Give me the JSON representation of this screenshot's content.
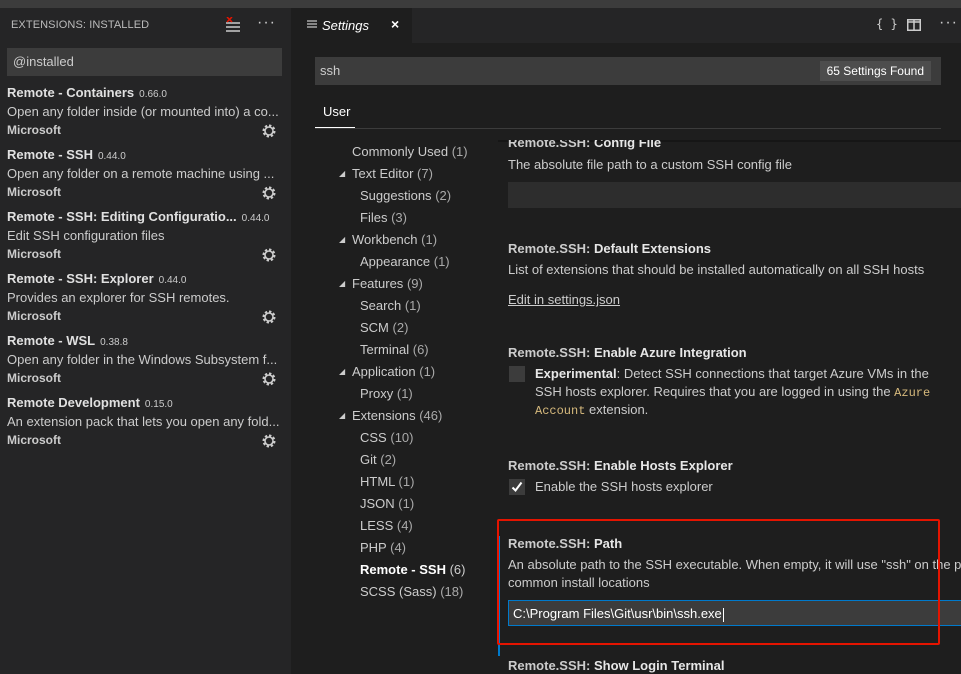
{
  "sidebar": {
    "title": "EXTENSIONS: INSTALLED",
    "search_value": "@installed",
    "extensions": [
      {
        "name": "Remote - Containers",
        "version": "0.66.0",
        "description": "Open any folder inside (or mounted into) a co...",
        "publisher": "Microsoft"
      },
      {
        "name": "Remote - SSH",
        "version": "0.44.0",
        "description": "Open any folder on a remote machine using ...",
        "publisher": "Microsoft"
      },
      {
        "name": "Remote - SSH: Editing Configuratio...",
        "version": "0.44.0",
        "description": "Edit SSH configuration files",
        "publisher": "Microsoft"
      },
      {
        "name": "Remote - SSH: Explorer",
        "version": "0.44.0",
        "description": "Provides an explorer for SSH remotes.",
        "publisher": "Microsoft"
      },
      {
        "name": "Remote - WSL",
        "version": "0.38.8",
        "description": "Open any folder in the Windows Subsystem f...",
        "publisher": "Microsoft"
      },
      {
        "name": "Remote Development",
        "version": "0.15.0",
        "description": "An extension pack that lets you open any fold...",
        "publisher": "Microsoft"
      }
    ]
  },
  "editor": {
    "tab_label": "Settings",
    "tab_close": "×",
    "actions": {
      "json": "{ }",
      "more": "···"
    },
    "search_value": "ssh",
    "found_badge": "65 Settings Found",
    "scope_tab": "User"
  },
  "tree": [
    {
      "label": "Commonly Used",
      "count": "(1)",
      "level": 0,
      "arrow": false
    },
    {
      "label": "Text Editor",
      "count": "(7)",
      "level": 0,
      "arrow": true
    },
    {
      "label": "Suggestions",
      "count": "(2)",
      "level": 1,
      "arrow": false
    },
    {
      "label": "Files",
      "count": "(3)",
      "level": 1,
      "arrow": false
    },
    {
      "label": "Workbench",
      "count": "(1)",
      "level": 0,
      "arrow": true
    },
    {
      "label": "Appearance",
      "count": "(1)",
      "level": 1,
      "arrow": false
    },
    {
      "label": "Features",
      "count": "(9)",
      "level": 0,
      "arrow": true
    },
    {
      "label": "Search",
      "count": "(1)",
      "level": 1,
      "arrow": false
    },
    {
      "label": "SCM",
      "count": "(2)",
      "level": 1,
      "arrow": false
    },
    {
      "label": "Terminal",
      "count": "(6)",
      "level": 1,
      "arrow": false
    },
    {
      "label": "Application",
      "count": "(1)",
      "level": 0,
      "arrow": true
    },
    {
      "label": "Proxy",
      "count": "(1)",
      "level": 1,
      "arrow": false
    },
    {
      "label": "Extensions",
      "count": "(46)",
      "level": 0,
      "arrow": true
    },
    {
      "label": "CSS",
      "count": "(10)",
      "level": 1,
      "arrow": false
    },
    {
      "label": "Git",
      "count": "(2)",
      "level": 1,
      "arrow": false
    },
    {
      "label": "HTML",
      "count": "(1)",
      "level": 1,
      "arrow": false
    },
    {
      "label": "JSON",
      "count": "(1)",
      "level": 1,
      "arrow": false
    },
    {
      "label": "LESS",
      "count": "(4)",
      "level": 1,
      "arrow": false
    },
    {
      "label": "PHP",
      "count": "(4)",
      "level": 1,
      "arrow": false
    },
    {
      "label": "Remote - SSH",
      "count": "(6)",
      "level": 1,
      "arrow": false,
      "selected": true
    },
    {
      "label": "SCSS (Sass)",
      "count": "(18)",
      "level": 1,
      "arrow": false
    }
  ],
  "settings": {
    "config_file": {
      "category": "Remote.SSH: ",
      "name": "Config File",
      "description": "The absolute file path to a custom SSH config file"
    },
    "default_extensions": {
      "category": "Remote.SSH: ",
      "name": "Default Extensions",
      "description": "List of extensions that should be installed automatically on all SSH hosts",
      "link": "Edit in settings.json"
    },
    "azure": {
      "category": "Remote.SSH: ",
      "name": "Enable Azure Integration",
      "line1_bold": "Experimental",
      "line1_rest": ": Detect SSH connections that target Azure VMs in the",
      "line2_pre": "SSH hosts explorer. Requires that you are logged in using the ",
      "line2_code": "Azure",
      "line3_code": "Account",
      "line3_rest": " extension.",
      "checked": false
    },
    "hosts_explorer": {
      "category": "Remote.SSH: ",
      "name": "Enable Hosts Explorer",
      "description": "Enable the SSH hosts explorer",
      "checked": true
    },
    "path": {
      "category": "Remote.SSH: ",
      "name": "Path",
      "description_line1": "An absolute path to the SSH executable. When empty, it will use \"ssh\" on the pa",
      "description_line2": "common install locations",
      "value": "C:\\Program Files\\Git\\usr\\bin\\ssh.exe"
    },
    "login_terminal": {
      "category": "Remote.SSH: ",
      "name": "Show Login Terminal"
    }
  },
  "colors": {
    "accent": "#007acc",
    "highlight": "#e51400",
    "code": "#d7ba7d"
  }
}
